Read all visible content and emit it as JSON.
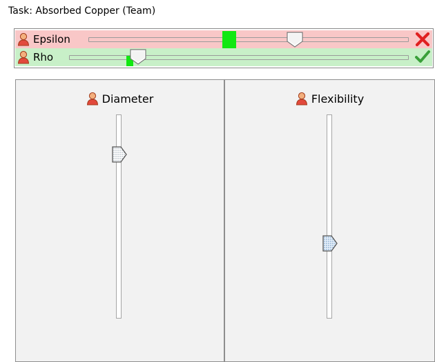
{
  "task": {
    "title": "Task: Absorbed Copper (Team)"
  },
  "rows": [
    {
      "label": "Epsilon",
      "icon": "user-icon",
      "status": "x-icon",
      "status_color": "#e02020",
      "background": "#f9c7c7",
      "marker_value": 0.44,
      "thumb_value": 0.64
    },
    {
      "label": "Rho",
      "icon": "user-icon",
      "status": "check-icon",
      "status_color": "#3aa03a",
      "background": "#c8f0c8",
      "marker_value": 0.18,
      "thumb_value": 0.2
    }
  ],
  "panels": [
    {
      "label": "Diameter",
      "icon": "user-icon",
      "value": 0.8
    },
    {
      "label": "Flexibility",
      "icon": "user-icon",
      "value": 0.37
    }
  ],
  "colors": {
    "marker": "#12e812",
    "error": "#e02020",
    "ok": "#3aa03a"
  }
}
